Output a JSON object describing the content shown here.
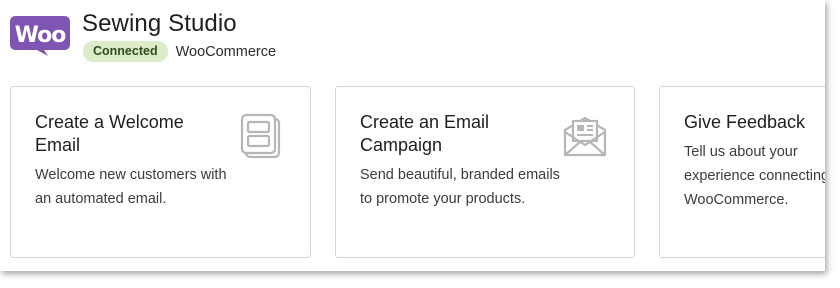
{
  "header": {
    "logo_text": "Woo",
    "store_name": "Sewing Studio",
    "status_badge": "Connected",
    "platform": "WooCommerce"
  },
  "cards": [
    {
      "title": "Create a Welcome Email",
      "description": "Welcome new customers with an automated email.",
      "icon": "document-icon"
    },
    {
      "title": "Create an Email Campaign",
      "description": "Send beautiful, branded emails to promote your products.",
      "icon": "envelope-icon"
    },
    {
      "title": "Give Feedback",
      "description": "Tell us about your experience connecting WooCommerce."
    }
  ],
  "colors": {
    "woo_purple": "#7f54b3",
    "badge_background": "#dcebc8",
    "badge_text": "#2f4d1c",
    "card_border": "#d3d5d8",
    "icon_gray": "#b4b6b9"
  }
}
